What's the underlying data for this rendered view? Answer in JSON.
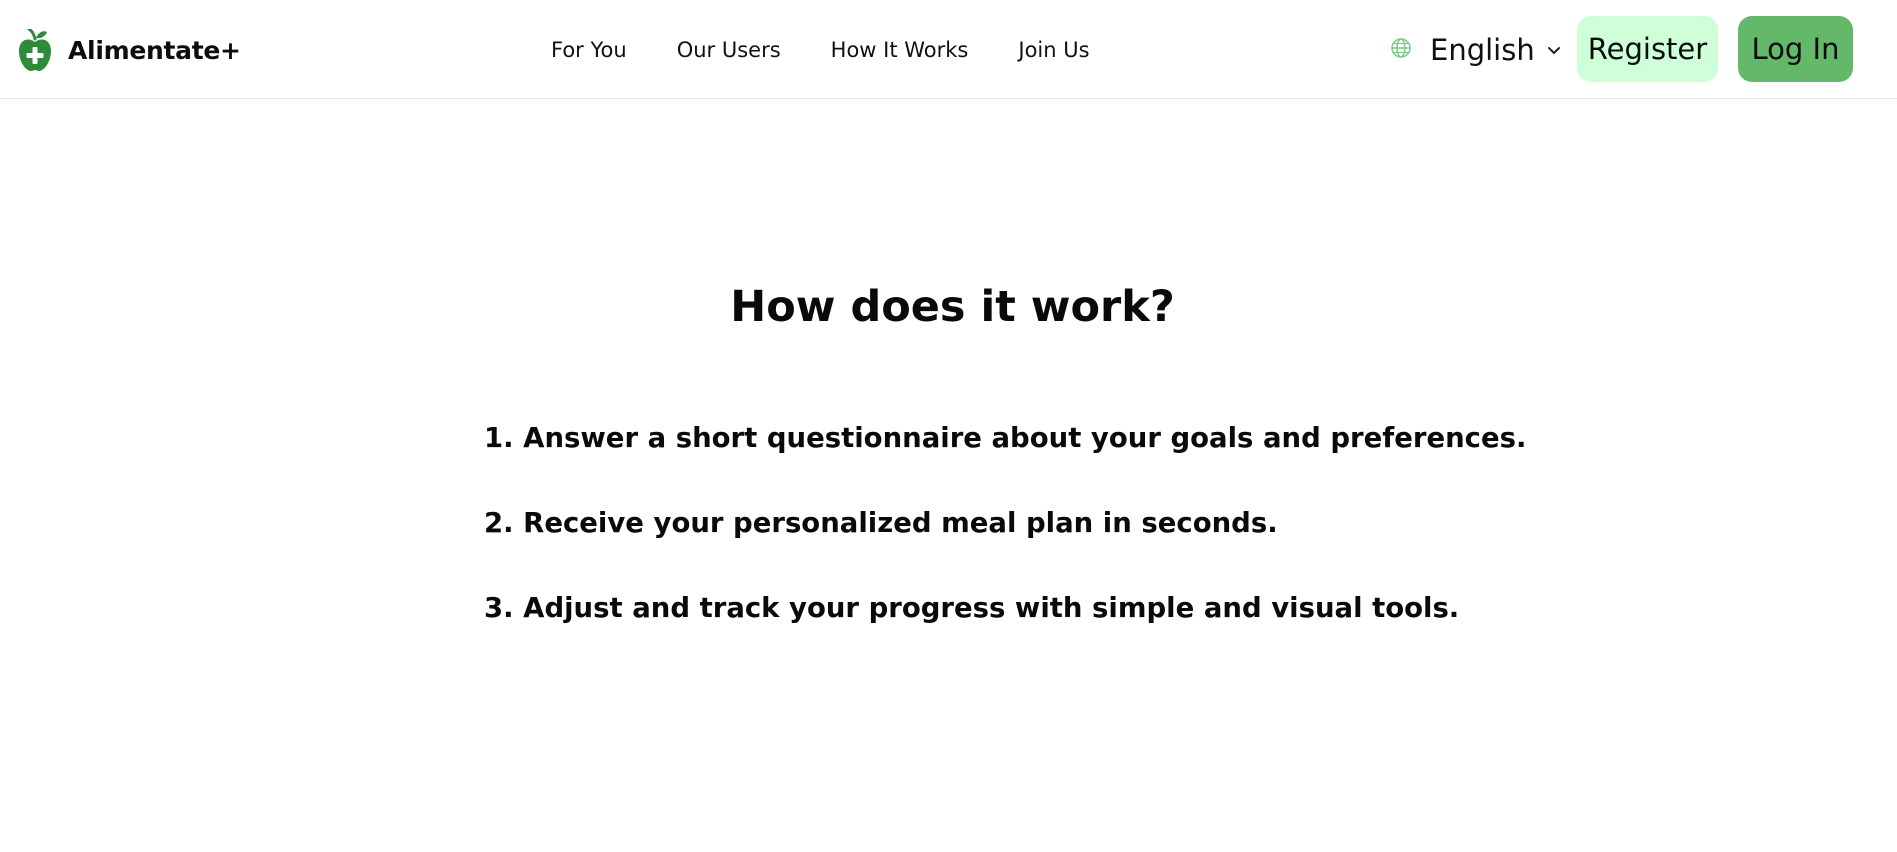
{
  "brand": {
    "name": "Alimentate+",
    "logo_icon": "apple-plus-icon",
    "logo_color": "#2e8b3c"
  },
  "nav": {
    "items": [
      {
        "label": "For You"
      },
      {
        "label": "Our Users"
      },
      {
        "label": "How It Works"
      },
      {
        "label": "Join Us"
      }
    ]
  },
  "language": {
    "icon": "globe-icon",
    "selected": "English",
    "chevron_icon": "chevron-down-icon"
  },
  "actions": {
    "register_label": "Register",
    "login_label": "Log In",
    "register_color": "#cfffd8",
    "login_color": "#63b86a"
  },
  "main": {
    "title": "How does it work?",
    "steps": [
      {
        "text": "1. Answer a short questionnaire about your goals and preferences."
      },
      {
        "text": "2. Receive your personalized meal plan in seconds."
      },
      {
        "text": "3. Adjust and track your progress with simple and visual tools."
      }
    ]
  }
}
